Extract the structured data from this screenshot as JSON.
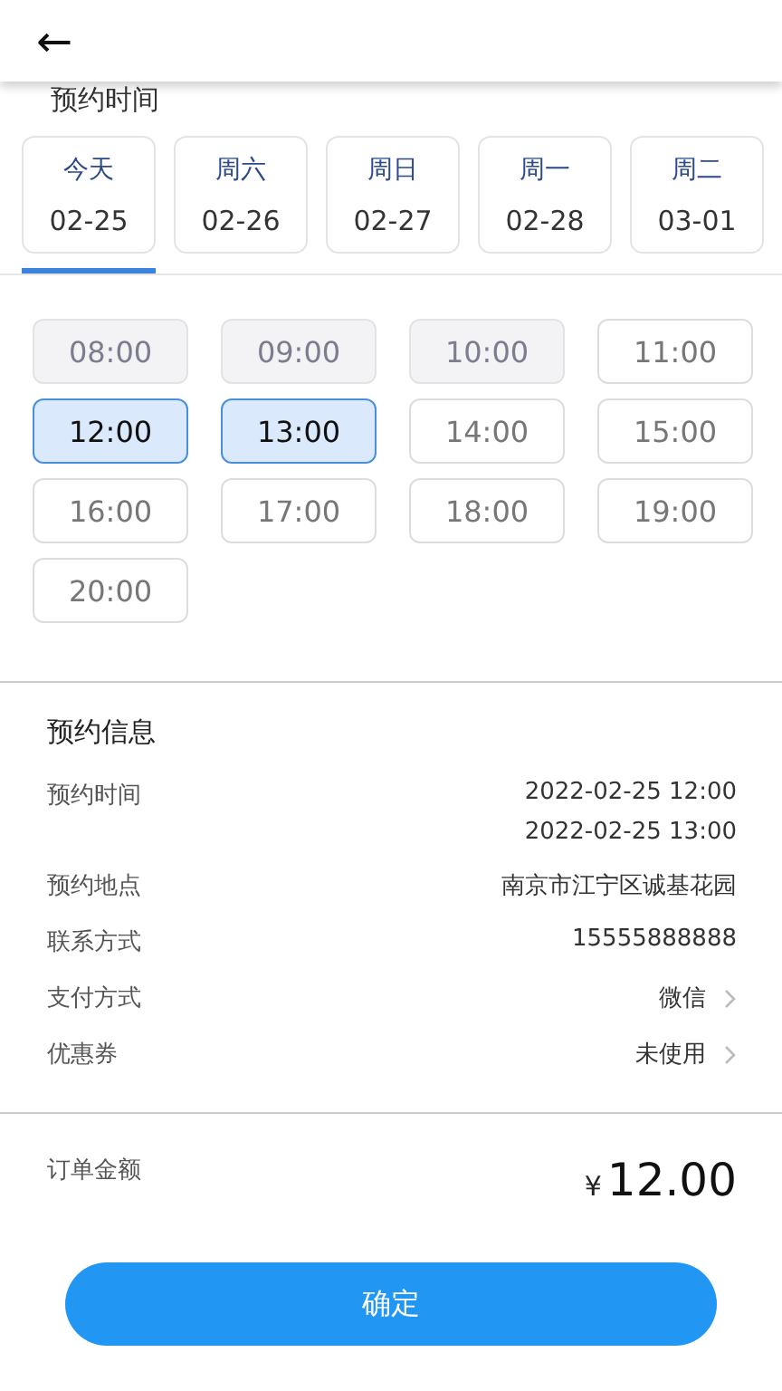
{
  "header": {
    "back": "←"
  },
  "schedule": {
    "title": "预约时间",
    "days": [
      {
        "weekday": "今天",
        "date": "02-25",
        "selected": true
      },
      {
        "weekday": "周六",
        "date": "02-26",
        "selected": false
      },
      {
        "weekday": "周日",
        "date": "02-27",
        "selected": false
      },
      {
        "weekday": "周一",
        "date": "02-28",
        "selected": false
      },
      {
        "weekday": "周二",
        "date": "03-01",
        "selected": false
      }
    ],
    "slots": [
      {
        "time": "08:00",
        "disabled": true,
        "selected": false
      },
      {
        "time": "09:00",
        "disabled": true,
        "selected": false
      },
      {
        "time": "10:00",
        "disabled": true,
        "selected": false
      },
      {
        "time": "11:00",
        "disabled": false,
        "selected": false
      },
      {
        "time": "12:00",
        "disabled": false,
        "selected": true
      },
      {
        "time": "13:00",
        "disabled": false,
        "selected": true
      },
      {
        "time": "14:00",
        "disabled": false,
        "selected": false
      },
      {
        "time": "15:00",
        "disabled": false,
        "selected": false
      },
      {
        "time": "16:00",
        "disabled": false,
        "selected": false
      },
      {
        "time": "17:00",
        "disabled": false,
        "selected": false
      },
      {
        "time": "18:00",
        "disabled": false,
        "selected": false
      },
      {
        "time": "19:00",
        "disabled": false,
        "selected": false
      },
      {
        "time": "20:00",
        "disabled": false,
        "selected": false
      }
    ]
  },
  "info": {
    "title": "预约信息",
    "rows": [
      {
        "label": "预约时间",
        "values": [
          "2022-02-25 12:00",
          "2022-02-25 13:00"
        ],
        "chevron": false
      },
      {
        "label": "预约地点",
        "values": [
          "南京市江宁区诚基花园"
        ],
        "chevron": false
      },
      {
        "label": "联系方式",
        "values": [
          "15555888888"
        ],
        "chevron": false
      },
      {
        "label": "支付方式",
        "values": [
          "微信"
        ],
        "chevron": true
      },
      {
        "label": "优惠券",
        "values": [
          "未使用"
        ],
        "chevron": true
      }
    ]
  },
  "total": {
    "label": "订单金额",
    "currency": "¥",
    "amount": "12.00"
  },
  "confirm_button": "确定"
}
